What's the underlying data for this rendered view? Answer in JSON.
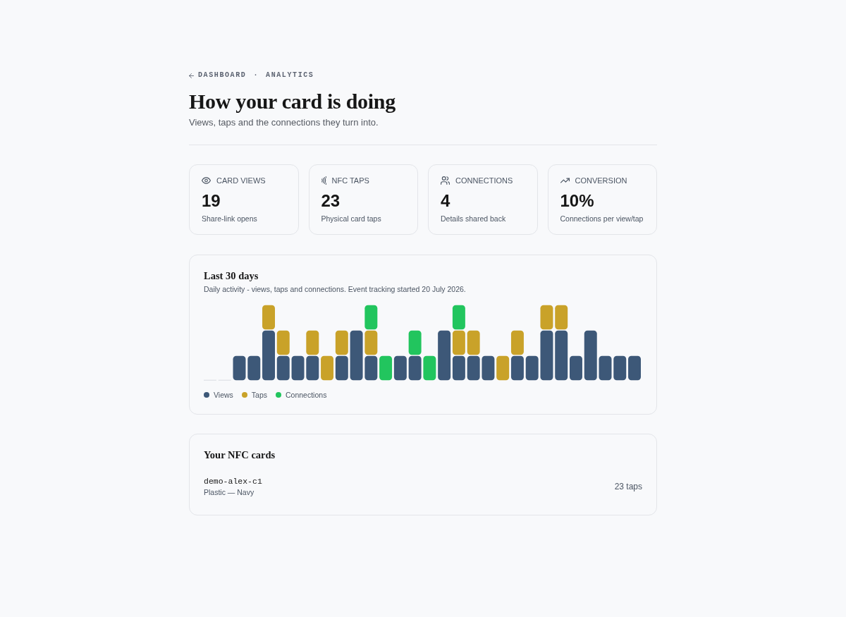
{
  "breadcrumb": {
    "items": [
      {
        "label": "DASHBOARD",
        "kind": "link"
      },
      {
        "label": "ANALYTICS",
        "kind": "current"
      }
    ],
    "separator": "·"
  },
  "header": {
    "title": "How your card is doing",
    "subtitle": "Views, taps and the connections they turn into."
  },
  "stats": [
    {
      "label": "CARD VIEWS",
      "value": "19",
      "caption": "Share-link opens"
    },
    {
      "label": "NFC TAPS",
      "value": "23",
      "caption": "Physical card taps"
    },
    {
      "label": "CONNECTIONS",
      "value": "4",
      "caption": "Details shared back"
    },
    {
      "label": "CONVERSION",
      "value": "10%",
      "caption": "Connections per view/tap"
    }
  ],
  "activity": {
    "title": "Last 30 days",
    "description": "Daily activity - views, taps and connections. Event tracking started 20 July 2026.",
    "legend": [
      {
        "name": "Views",
        "color": "#3d5878"
      },
      {
        "name": "Taps",
        "color": "#c9a229"
      },
      {
        "name": "Connections",
        "color": "#22c55e"
      }
    ]
  },
  "nfc_cards": {
    "title": "Your NFC cards",
    "cards": [
      {
        "name": "demo-alex-c1",
        "material": "Plastic — Navy",
        "taps": "23 taps"
      }
    ]
  }
}
